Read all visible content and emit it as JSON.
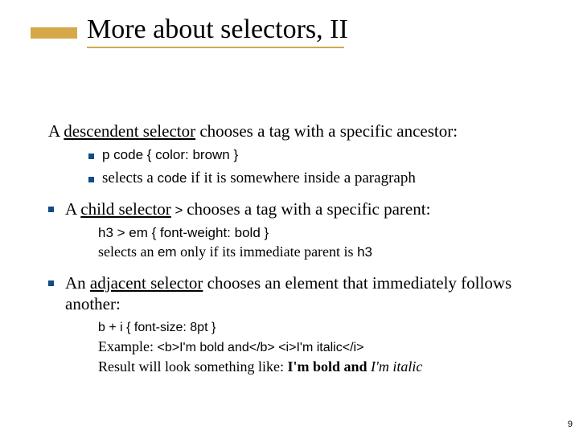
{
  "title": "More about selectors, II",
  "page_number": "9",
  "p1": {
    "pre": "A ",
    "u": "descendent selector",
    "post": " chooses a tag with a specific ancestor:"
  },
  "p1s1": "p code { color: brown }",
  "p1s2": {
    "a": "selects a ",
    "b": "code",
    "c": " if it is somewhere inside a paragraph"
  },
  "p2": {
    "pre": "A ",
    "u": "child selector",
    "sym": " > ",
    "post": "chooses a tag with a specific parent:"
  },
  "p2s1": "h3 > em { font-weight: bold }",
  "p2s2": {
    "a": "selects an ",
    "b": "em",
    "c": " only if its immediate parent is ",
    "d": "h3"
  },
  "p3": {
    "pre": "An ",
    "u": "adjacent selector",
    "post": " chooses an element that immediately follows another:"
  },
  "p3s1": "b + i { font-size: 8pt }",
  "p3s2": {
    "a": "Example: ",
    "b": "<b>I'm bold and</b> <i>I'm italic</i>"
  },
  "p3s3": {
    "a": "Result will look something like: ",
    "b": "I'm bold and",
    "c": " I'm italic"
  }
}
